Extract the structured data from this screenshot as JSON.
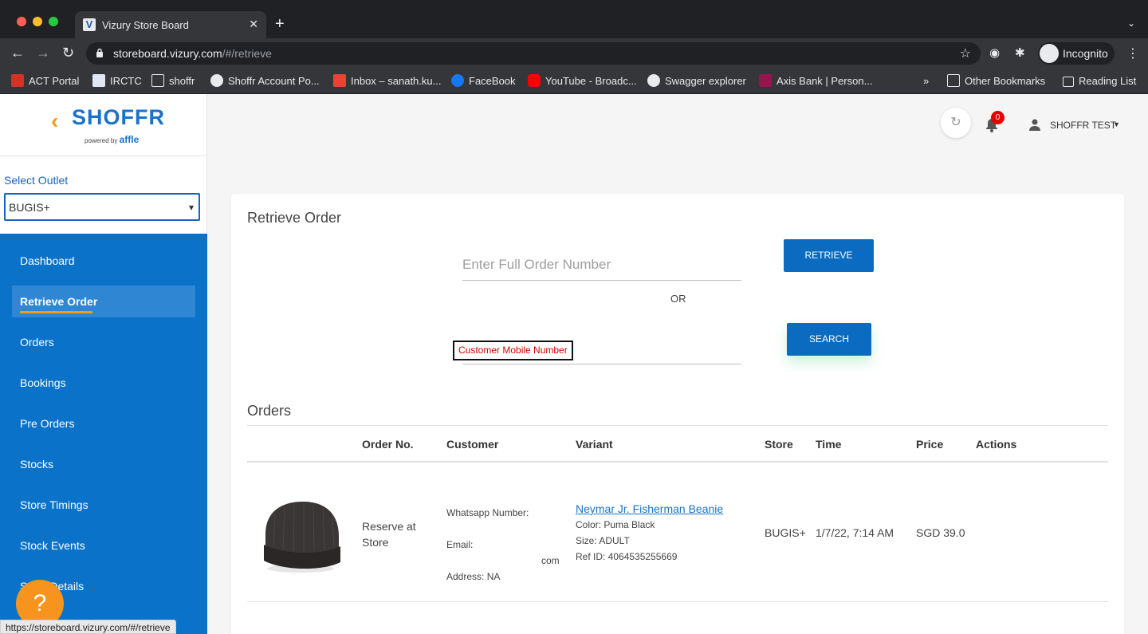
{
  "browser": {
    "tab_title": "Vizury Store Board",
    "tab_favicon": "V",
    "url_host": "storeboard.vizury.com",
    "url_path": "/#/retrieve",
    "incognito_label": "Incognito",
    "bookmarks": [
      {
        "label": "ACT Portal",
        "icon": "act-icon"
      },
      {
        "label": "IRCTC",
        "icon": "irctc-icon"
      },
      {
        "label": "shoffr",
        "icon": "folder-icon"
      },
      {
        "label": "Shoffr Account Po...",
        "icon": "globe-icon"
      },
      {
        "label": "Inbox – sanath.ku...",
        "icon": "gmail-icon"
      },
      {
        "label": "FaceBook",
        "icon": "facebook-icon"
      },
      {
        "label": "YouTube - Broadc...",
        "icon": "youtube-icon"
      },
      {
        "label": "Swagger explorer",
        "icon": "globe-icon"
      },
      {
        "label": "Axis Bank | Person...",
        "icon": "axis-icon"
      }
    ],
    "bookmarks_overflow": "»",
    "other_bookmarks": "Other Bookmarks",
    "reading_list": "Reading List",
    "status_url": "https://storeboard.vizury.com/#/retrieve"
  },
  "brand": {
    "name": "SHOFFR",
    "powered_by": "powered by",
    "partner": "affle",
    "accent": "#f39c12",
    "primary": "#0a72c8"
  },
  "outlet": {
    "label": "Select Outlet",
    "value": "BUGIS+"
  },
  "nav": {
    "items": [
      {
        "label": "Dashboard"
      },
      {
        "label": "Retrieve Order",
        "active": true
      },
      {
        "label": "Orders"
      },
      {
        "label": "Bookings"
      },
      {
        "label": "Pre Orders"
      },
      {
        "label": "Stocks"
      },
      {
        "label": "Store Timings"
      },
      {
        "label": "Stock Events"
      },
      {
        "label": "Store Details"
      }
    ]
  },
  "header": {
    "notification_count": "0",
    "user_name": "SHOFFR TEST"
  },
  "retrieve": {
    "title": "Retrieve Order",
    "order_placeholder": "Enter Full Order Number",
    "retrieve_button": "RETRIEVE",
    "or_text": "OR",
    "mobile_label": "Customer Mobile Number",
    "search_button": "SEARCH"
  },
  "orders": {
    "title": "Orders",
    "columns": [
      "Order No.",
      "Customer",
      "Variant",
      "Store",
      "Time",
      "Price",
      "Actions"
    ],
    "rows": [
      {
        "image": "beanie-image",
        "order_no": "Reserve at Store",
        "whatsapp_label": "Whatsapp Number:",
        "email_label": "Email:",
        "email_tail": "com",
        "address_label": "Address: NA",
        "variant_name": "Neymar Jr. Fisherman Beanie",
        "color": "Color: Puma Black",
        "size": "Size: ADULT",
        "ref_id": "Ref ID: 4064535255669",
        "store": "BUGIS+",
        "time": "1/7/22, 7:14 AM",
        "price": "SGD 39.0"
      }
    ]
  },
  "help": {
    "label": "?"
  }
}
